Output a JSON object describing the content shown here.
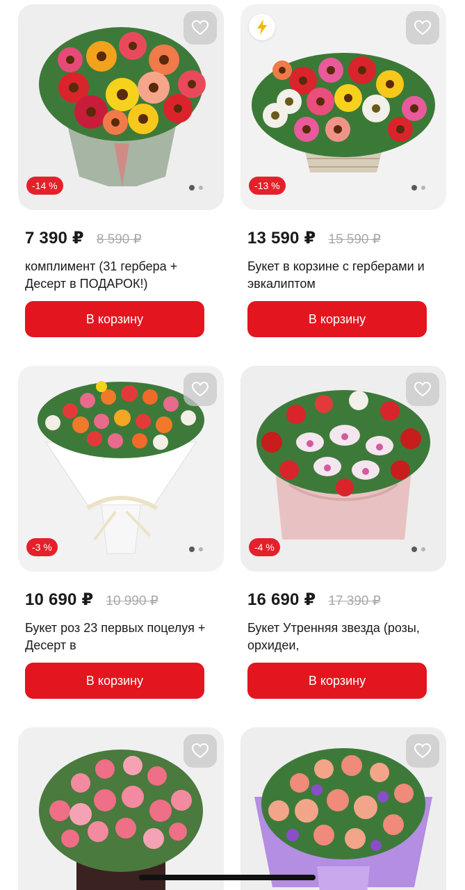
{
  "products": [
    {
      "price": "7 390 ₽",
      "old_price": "8 590 ₽",
      "title": "комплимент (31 гербера + Десерт в ПОДАРОК!)",
      "discount": "-14 %",
      "cart_label": "В корзину",
      "has_express_badge": false,
      "image_icon": "gerbera-bouquet-image"
    },
    {
      "price": "13 590 ₽",
      "old_price": "15 590 ₽",
      "title": "Букет в корзине с герберами и эвкалиптом",
      "discount": "-13 %",
      "cart_label": "В корзину",
      "has_express_badge": true,
      "image_icon": "gerbera-basket-image"
    },
    {
      "price": "10 690 ₽",
      "old_price": "10 990 ₽",
      "title": "Букет роз 23 первых поцелуя + Десерт в",
      "discount": "-3 %",
      "cart_label": "В корзину",
      "has_express_badge": false,
      "image_icon": "rose-bouquet-image"
    },
    {
      "price": "16 690 ₽",
      "old_price": "17 390 ₽",
      "title": "Букет Утренняя звезда (розы, орхидеи,",
      "discount": "-4 %",
      "cart_label": "В корзину",
      "has_express_badge": false,
      "image_icon": "rose-orchid-bouquet-image"
    },
    {
      "image_icon": "pink-rose-box-image"
    },
    {
      "image_icon": "peach-rose-bouquet-image"
    }
  ],
  "icons": {
    "favorite": "heart-outline-icon",
    "express": "lightning-bolt-icon"
  },
  "colors": {
    "accent": "#e3151f",
    "discount_badge": "#e4202b",
    "express_bolt": "#f5b800"
  }
}
